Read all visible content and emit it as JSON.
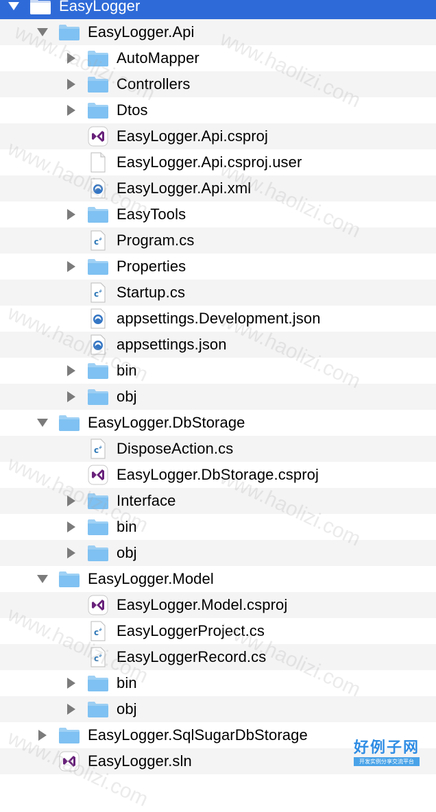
{
  "colors": {
    "selection": "#2f6bd8",
    "folder": "#7fc1f2",
    "vs_purple": "#68217a",
    "cs_blue": "#2f78b7",
    "json_blue": "#3476c4"
  },
  "tree": [
    {
      "label": "EasyLogger",
      "depth": 0,
      "type": "folder",
      "expanded": true,
      "selected": true
    },
    {
      "label": "EasyLogger.Api",
      "depth": 1,
      "type": "folder",
      "expanded": true
    },
    {
      "label": "AutoMapper",
      "depth": 2,
      "type": "folder",
      "expanded": false
    },
    {
      "label": "Controllers",
      "depth": 2,
      "type": "folder",
      "expanded": false
    },
    {
      "label": "Dtos",
      "depth": 2,
      "type": "folder",
      "expanded": false
    },
    {
      "label": "EasyLogger.Api.csproj",
      "depth": 2,
      "type": "csproj"
    },
    {
      "label": "EasyLogger.Api.csproj.user",
      "depth": 2,
      "type": "file"
    },
    {
      "label": "EasyLogger.Api.xml",
      "depth": 2,
      "type": "json"
    },
    {
      "label": "EasyTools",
      "depth": 2,
      "type": "folder",
      "expanded": false
    },
    {
      "label": "Program.cs",
      "depth": 2,
      "type": "cs"
    },
    {
      "label": "Properties",
      "depth": 2,
      "type": "folder",
      "expanded": false
    },
    {
      "label": "Startup.cs",
      "depth": 2,
      "type": "cs"
    },
    {
      "label": "appsettings.Development.json",
      "depth": 2,
      "type": "json"
    },
    {
      "label": "appsettings.json",
      "depth": 2,
      "type": "json"
    },
    {
      "label": "bin",
      "depth": 2,
      "type": "folder",
      "expanded": false
    },
    {
      "label": "obj",
      "depth": 2,
      "type": "folder",
      "expanded": false
    },
    {
      "label": "EasyLogger.DbStorage",
      "depth": 1,
      "type": "folder",
      "expanded": true
    },
    {
      "label": "DisposeAction.cs",
      "depth": 2,
      "type": "cs"
    },
    {
      "label": "EasyLogger.DbStorage.csproj",
      "depth": 2,
      "type": "csproj"
    },
    {
      "label": "Interface",
      "depth": 2,
      "type": "folder",
      "expanded": false
    },
    {
      "label": "bin",
      "depth": 2,
      "type": "folder",
      "expanded": false
    },
    {
      "label": "obj",
      "depth": 2,
      "type": "folder",
      "expanded": false
    },
    {
      "label": "EasyLogger.Model",
      "depth": 1,
      "type": "folder",
      "expanded": true
    },
    {
      "label": "EasyLogger.Model.csproj",
      "depth": 2,
      "type": "csproj"
    },
    {
      "label": "EasyLoggerProject.cs",
      "depth": 2,
      "type": "cs"
    },
    {
      "label": "EasyLoggerRecord.cs",
      "depth": 2,
      "type": "cs"
    },
    {
      "label": "bin",
      "depth": 2,
      "type": "folder",
      "expanded": false
    },
    {
      "label": "obj",
      "depth": 2,
      "type": "folder",
      "expanded": false
    },
    {
      "label": "EasyLogger.SqlSugarDbStorage",
      "depth": 1,
      "type": "folder",
      "expanded": false
    },
    {
      "label": "EasyLogger.sln",
      "depth": 1,
      "type": "csproj"
    }
  ],
  "watermark": {
    "text": "www.haolizi.com"
  },
  "brand": {
    "title": "好例子网",
    "subtitle": "开发实例分享交流平台"
  }
}
